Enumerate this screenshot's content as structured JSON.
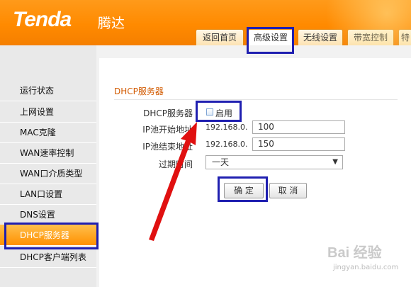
{
  "brand": {
    "logo_text": "Tenda",
    "logo_cn": "腾达"
  },
  "tabs": [
    {
      "label": "返回首页"
    },
    {
      "label": "高级设置"
    },
    {
      "label": "无线设置"
    },
    {
      "label": "带宽控制"
    },
    {
      "label": "特"
    }
  ],
  "sidebar": {
    "items": [
      {
        "label": "运行状态"
      },
      {
        "label": "上网设置"
      },
      {
        "label": "MAC克隆"
      },
      {
        "label": "WAN速率控制"
      },
      {
        "label": "WAN口介质类型"
      },
      {
        "label": "LAN口设置"
      },
      {
        "label": "DNS设置"
      },
      {
        "label": "DHCP服务器"
      },
      {
        "label": "DHCP客户端列表"
      }
    ],
    "active_index": 7
  },
  "form": {
    "section_title": "DHCP服务器",
    "dhcp_label": "DHCP服务器",
    "enable_label": "启用",
    "enabled": false,
    "start_label": "IP池开始地址",
    "end_label": "IP池结束地址",
    "ip_prefix": "192.168.0.",
    "start_value": "100",
    "end_value": "150",
    "lease_label": "过期时间",
    "lease_value": "一天",
    "ok_label": "确 定",
    "cancel_label": "取 消"
  },
  "watermark": {
    "text": "Bai 经验",
    "url": "jingyan.baidu.com"
  },
  "colors": {
    "accent": "#ff8a00",
    "callout": "#1f1fb0",
    "arrow": "#e01010",
    "section_title": "#d25a00"
  }
}
